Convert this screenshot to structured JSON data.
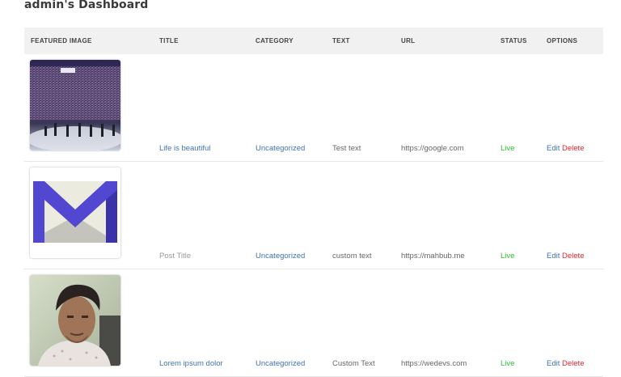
{
  "page": {
    "title": "admin's Dashboard"
  },
  "table": {
    "headers": [
      "FEATURED IMAGE",
      "TITLE",
      "CATEGORY",
      "TEXT",
      "URL",
      "STATUS",
      "OPTIONS"
    ],
    "rows": [
      {
        "title": "Life is beautiful",
        "category": "Uncategorized",
        "text": "Test text",
        "url": "https://google.com",
        "status": "Live",
        "edit": "Edit",
        "delete": "Delete",
        "image": "crowd-photo"
      },
      {
        "title": "Post Title",
        "category": "Uncategorized",
        "text": "custom text",
        "url": "https://mahbub.me",
        "status": "Live",
        "edit": "Edit",
        "delete": "Delete",
        "image": "gmail-envelope-logo"
      },
      {
        "title": "Lorem ipsum dolor",
        "category": "Uncategorized",
        "text": "Custom Text",
        "url": "https://wedevs.com",
        "status": "Live",
        "edit": "Edit",
        "delete": "Delete",
        "image": "portrait-photo"
      }
    ]
  },
  "colors": {
    "link": "#3f73b4",
    "live": "#2ec231",
    "delete": "#e3262e",
    "header_bg": "#f1f1f1"
  }
}
